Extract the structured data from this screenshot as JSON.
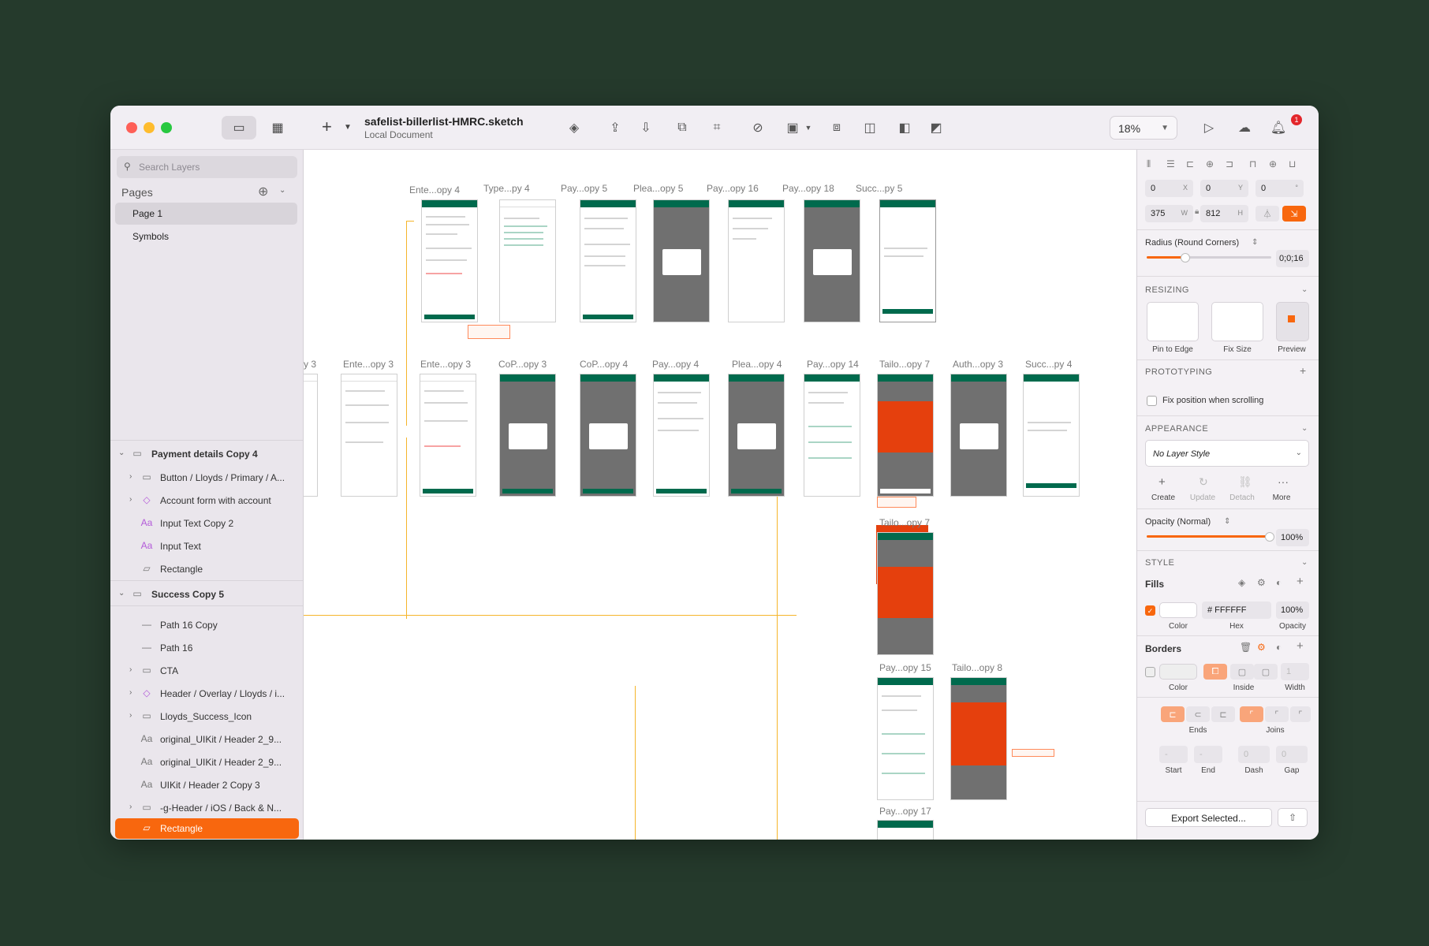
{
  "document": {
    "title": "safelist-billerlist-HMRC.sketch",
    "subtitle": "Local Document"
  },
  "toolbar": {
    "zoom": "18%",
    "notifications": "1"
  },
  "sidebar": {
    "search_placeholder": "Search Layers",
    "pages_header": "Pages",
    "pages": [
      "Page 1",
      "Symbols"
    ],
    "layers": [
      {
        "label": "Payment details Copy 4",
        "type": "group"
      },
      {
        "label": "Button / Lloyds / Primary / A...",
        "type": "symbol"
      },
      {
        "label": "Account form with account",
        "type": "symbol"
      },
      {
        "label": "Input Text Copy 2",
        "type": "text-sym"
      },
      {
        "label": "Input Text",
        "type": "text-sym"
      },
      {
        "label": "Rectangle",
        "type": "shape"
      },
      {
        "label": "Success Copy 5",
        "type": "group"
      },
      {
        "label": "Path 16 Copy",
        "type": "path"
      },
      {
        "label": "Path 16",
        "type": "path"
      },
      {
        "label": "CTA",
        "type": "folder"
      },
      {
        "label": "Header / Overlay / Lloyds / i...",
        "type": "symbol"
      },
      {
        "label": "Lloyds_Success_Icon",
        "type": "folder"
      },
      {
        "label": "original_UIKit / Header 2_9...",
        "type": "text"
      },
      {
        "label": "original_UIKit / Header 2_9...",
        "type": "text"
      },
      {
        "label": "UIKit / Header 2 Copy 3",
        "type": "text"
      },
      {
        "label": "-g-Header / iOS / Back & N...",
        "type": "folder"
      },
      {
        "label": "Rectangle",
        "type": "shape-selected"
      }
    ]
  },
  "canvas": {
    "labels_row1": [
      "Ente...opy 4",
      "Type...py 4",
      "Pay...opy 5",
      "Plea...opy 5",
      "Pay...opy 16",
      "Pay...opy 18",
      "Succ...py 5"
    ],
    "labels_row2": [
      "y 3",
      "Ente...opy 3",
      "Ente...opy 3",
      "CoP...opy 3",
      "CoP...opy 4",
      "Pay...opy 4",
      "Plea...opy 4",
      "Pay...opy 14",
      "Tailo...opy 7",
      "Auth...opy 3",
      "Succ...py 4"
    ],
    "labels_extra": [
      "Tailo...opy 7",
      "Pay...opy 15",
      "Tailo...opy 8",
      "Pay...opy 17"
    ]
  },
  "inspector": {
    "x": "0",
    "y": "0",
    "rotation": "0",
    "width": "375",
    "height": "812",
    "radius_label": "Radius (Round Corners)",
    "radius_value": "0;0;16",
    "resizing": "RESIZING",
    "pin_to_edge": "Pin to Edge",
    "fix_size": "Fix Size",
    "preview": "Preview",
    "prototyping": "PROTOTYPING",
    "fix_position": "Fix position when scrolling",
    "appearance": "APPEARANCE",
    "layer_style": "No Layer Style",
    "actions": [
      "Create",
      "Update",
      "Detach",
      "More"
    ],
    "opacity_label": "Opacity (Normal)",
    "opacity_value": "100%",
    "opacity": 1.0,
    "style": "STYLE",
    "fills": "Fills",
    "fill_hex": "# FFFFFF",
    "fill_opacity": "100%",
    "fill_labels": [
      "Color",
      "Hex",
      "Opacity"
    ],
    "borders": "Borders",
    "border_width": "1",
    "border_labels": [
      "Color",
      "Inside",
      "Width"
    ],
    "ends_label": "Ends",
    "joins_label": "Joins",
    "dash_labels": [
      "Start",
      "End",
      "Dash",
      "Gap"
    ],
    "dash_values": [
      "0",
      "0"
    ],
    "export": "Export Selected...",
    "accent": "#f8670e"
  }
}
